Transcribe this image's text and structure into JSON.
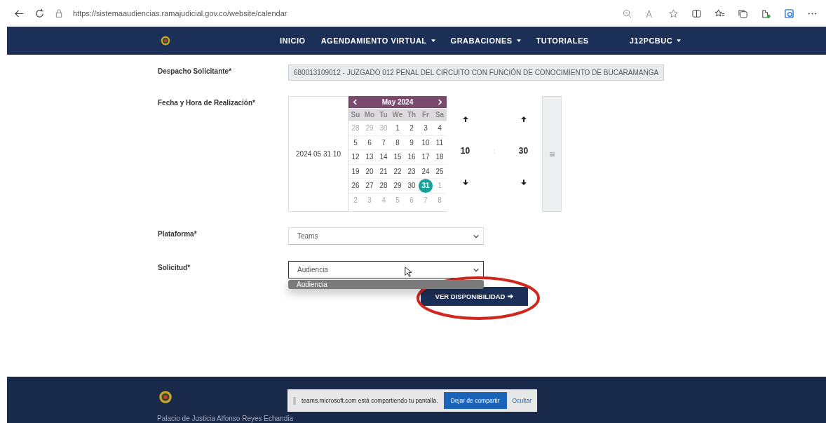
{
  "browser": {
    "url": "https://sistemaaudiencias.ramajudicial.gov.co/website/calendar"
  },
  "nav": {
    "items": [
      {
        "label": "INICIO",
        "dropdown": false
      },
      {
        "label": "AGENDAMIENTO VIRTUAL",
        "dropdown": true
      },
      {
        "label": "GRABACIONES",
        "dropdown": true
      },
      {
        "label": "TUTORIALES",
        "dropdown": false
      }
    ],
    "user": {
      "label": "J12PCBUC",
      "dropdown": true
    }
  },
  "form": {
    "despacho": {
      "label": "Despacho Solicitante*",
      "value": "680013109012 - JUZGADO 012 PENAL DEL CIRCUITO CON FUNCIÓN DE CONOCIMIENTO DE BUCARAMANGA"
    },
    "fecha": {
      "label": "Fecha y Hora de Realización*",
      "value": "2024 05 31 10",
      "calendar": {
        "month": "May 2024",
        "weekdays": [
          "Su",
          "Mo",
          "Tu",
          "We",
          "Th",
          "Fr",
          "Sa"
        ],
        "weeks": [
          [
            {
              "day": "28",
              "muted": true,
              "selected": false
            },
            {
              "day": "29",
              "muted": true,
              "selected": false
            },
            {
              "day": "30",
              "muted": true,
              "selected": false
            },
            {
              "day": "1",
              "muted": false,
              "selected": false
            },
            {
              "day": "2",
              "muted": false,
              "selected": false
            },
            {
              "day": "3",
              "muted": false,
              "selected": false
            },
            {
              "day": "4",
              "muted": false,
              "selected": false
            }
          ],
          [
            {
              "day": "5",
              "muted": false,
              "selected": false
            },
            {
              "day": "6",
              "muted": false,
              "selected": false
            },
            {
              "day": "7",
              "muted": false,
              "selected": false
            },
            {
              "day": "8",
              "muted": false,
              "selected": false
            },
            {
              "day": "9",
              "muted": false,
              "selected": false
            },
            {
              "day": "10",
              "muted": false,
              "selected": false
            },
            {
              "day": "11",
              "muted": false,
              "selected": false
            }
          ],
          [
            {
              "day": "12",
              "muted": false,
              "selected": false
            },
            {
              "day": "13",
              "muted": false,
              "selected": false
            },
            {
              "day": "14",
              "muted": false,
              "selected": false
            },
            {
              "day": "15",
              "muted": false,
              "selected": false
            },
            {
              "day": "16",
              "muted": false,
              "selected": false
            },
            {
              "day": "17",
              "muted": false,
              "selected": false
            },
            {
              "day": "18",
              "muted": false,
              "selected": false
            }
          ],
          [
            {
              "day": "19",
              "muted": false,
              "selected": false
            },
            {
              "day": "20",
              "muted": false,
              "selected": false
            },
            {
              "day": "21",
              "muted": false,
              "selected": false
            },
            {
              "day": "22",
              "muted": false,
              "selected": false
            },
            {
              "day": "23",
              "muted": false,
              "selected": false
            },
            {
              "day": "24",
              "muted": false,
              "selected": false
            },
            {
              "day": "25",
              "muted": false,
              "selected": false
            }
          ],
          [
            {
              "day": "26",
              "muted": false,
              "selected": false
            },
            {
              "day": "27",
              "muted": false,
              "selected": false
            },
            {
              "day": "28",
              "muted": false,
              "selected": false
            },
            {
              "day": "29",
              "muted": false,
              "selected": false
            },
            {
              "day": "30",
              "muted": false,
              "selected": false
            },
            {
              "day": "31",
              "muted": false,
              "selected": true
            },
            {
              "day": "1",
              "muted": true,
              "selected": false
            }
          ],
          [
            {
              "day": "2",
              "muted": true,
              "selected": false
            },
            {
              "day": "3",
              "muted": true,
              "selected": false
            },
            {
              "day": "4",
              "muted": true,
              "selected": false
            },
            {
              "day": "5",
              "muted": true,
              "selected": false
            },
            {
              "day": "6",
              "muted": true,
              "selected": false
            },
            {
              "day": "7",
              "muted": true,
              "selected": false
            },
            {
              "day": "8",
              "muted": true,
              "selected": false
            }
          ]
        ]
      },
      "time": {
        "hour": "10",
        "separator": ":",
        "minute": "30"
      }
    },
    "plataforma": {
      "label": "Plataforma*",
      "value": "Teams"
    },
    "solicitud": {
      "label": "Solicitud*",
      "value": "Audiencia",
      "options": [
        {
          "label": "Audiencia",
          "highlighted": true
        }
      ]
    },
    "button": "VER DISPONIBILIDAD"
  },
  "share_bar": {
    "message": "teams.microsoft.com está compartiendo tu pantalla.",
    "stop": "Dejar de compartir",
    "hide": "Ocultar"
  },
  "footer": {
    "address": "Palacio de Justicia Alfonso Reyes Echandia"
  }
}
